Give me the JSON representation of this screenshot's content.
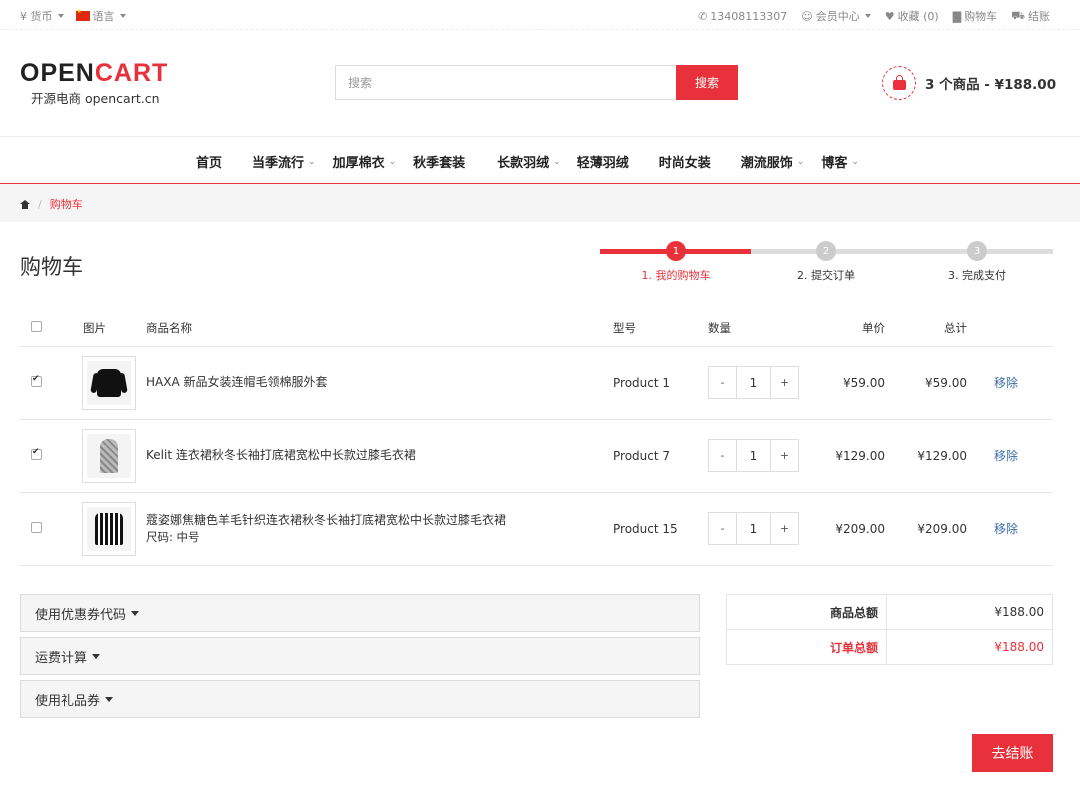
{
  "topbar": {
    "currency": "¥ 货币",
    "language": "语言",
    "phone": "13408113307",
    "account": "会员中心",
    "wishlist": "收藏 (0)",
    "cart": "购物车",
    "checkout": "结账"
  },
  "header": {
    "logo_dark": "OPEN",
    "logo_red": "CART",
    "logo_sub": "开源电商 opencart.cn",
    "search_placeholder": "搜索",
    "search_button": "搜索",
    "cart_summary": "3 个商品 - ¥188.00"
  },
  "nav": {
    "items": [
      {
        "label": "首页",
        "has_dropdown": false
      },
      {
        "label": "当季流行",
        "has_dropdown": true
      },
      {
        "label": "加厚棉衣",
        "has_dropdown": true
      },
      {
        "label": "秋季套装",
        "has_dropdown": false
      },
      {
        "label": "长款羽绒",
        "has_dropdown": true
      },
      {
        "label": "轻薄羽绒",
        "has_dropdown": false
      },
      {
        "label": "时尚女装",
        "has_dropdown": false
      },
      {
        "label": "潮流服饰",
        "has_dropdown": true
      },
      {
        "label": "博客",
        "has_dropdown": true
      }
    ]
  },
  "breadcrumb": {
    "current": "购物车"
  },
  "page": {
    "title": "购物车"
  },
  "steps": [
    {
      "num": "1",
      "label": "1. 我的购物车",
      "active": true
    },
    {
      "num": "2",
      "label": "2. 提交订单",
      "active": false
    },
    {
      "num": "3",
      "label": "3. 完成支付",
      "active": false
    }
  ],
  "table": {
    "headers": {
      "image": "图片",
      "name": "商品名称",
      "model": "型号",
      "quantity": "数量",
      "unit_price": "单价",
      "total": "总计"
    },
    "rows": [
      {
        "checked": true,
        "name": "HAXA 新品女装连帽毛领棉服外套",
        "option": "",
        "model": "Product 1",
        "qty": "1",
        "unit_price": "¥59.00",
        "total": "¥59.00",
        "remove": "移除",
        "image_icon": "jacket-image"
      },
      {
        "checked": true,
        "name": "Kelit 连衣裙秋冬长袖打底裙宽松中长款过膝毛衣裙",
        "option": "",
        "model": "Product 7",
        "qty": "1",
        "unit_price": "¥129.00",
        "total": "¥129.00",
        "remove": "移除",
        "image_icon": "scarf-image"
      },
      {
        "checked": false,
        "name": "蔻姿娜焦糖色羊毛针织连衣裙秋冬长袖打底裙宽松中长款过膝毛衣裙",
        "option": "尺码: 中号",
        "model": "Product 15",
        "qty": "1",
        "unit_price": "¥209.00",
        "total": "¥209.00",
        "remove": "移除",
        "image_icon": "striped-jacket-image"
      }
    ],
    "qty_minus": "-",
    "qty_plus": "+"
  },
  "panels": {
    "coupon": "使用优惠券代码",
    "shipping": "运费计算",
    "voucher": "使用礼品券"
  },
  "totals": {
    "subtotal_label": "商品总额",
    "subtotal_value": "¥188.00",
    "total_label": "订单总额",
    "total_value": "¥188.00"
  },
  "checkout_button": "去结账",
  "colors": {
    "accent": "#e8313a",
    "link": "#3a6ea5"
  }
}
